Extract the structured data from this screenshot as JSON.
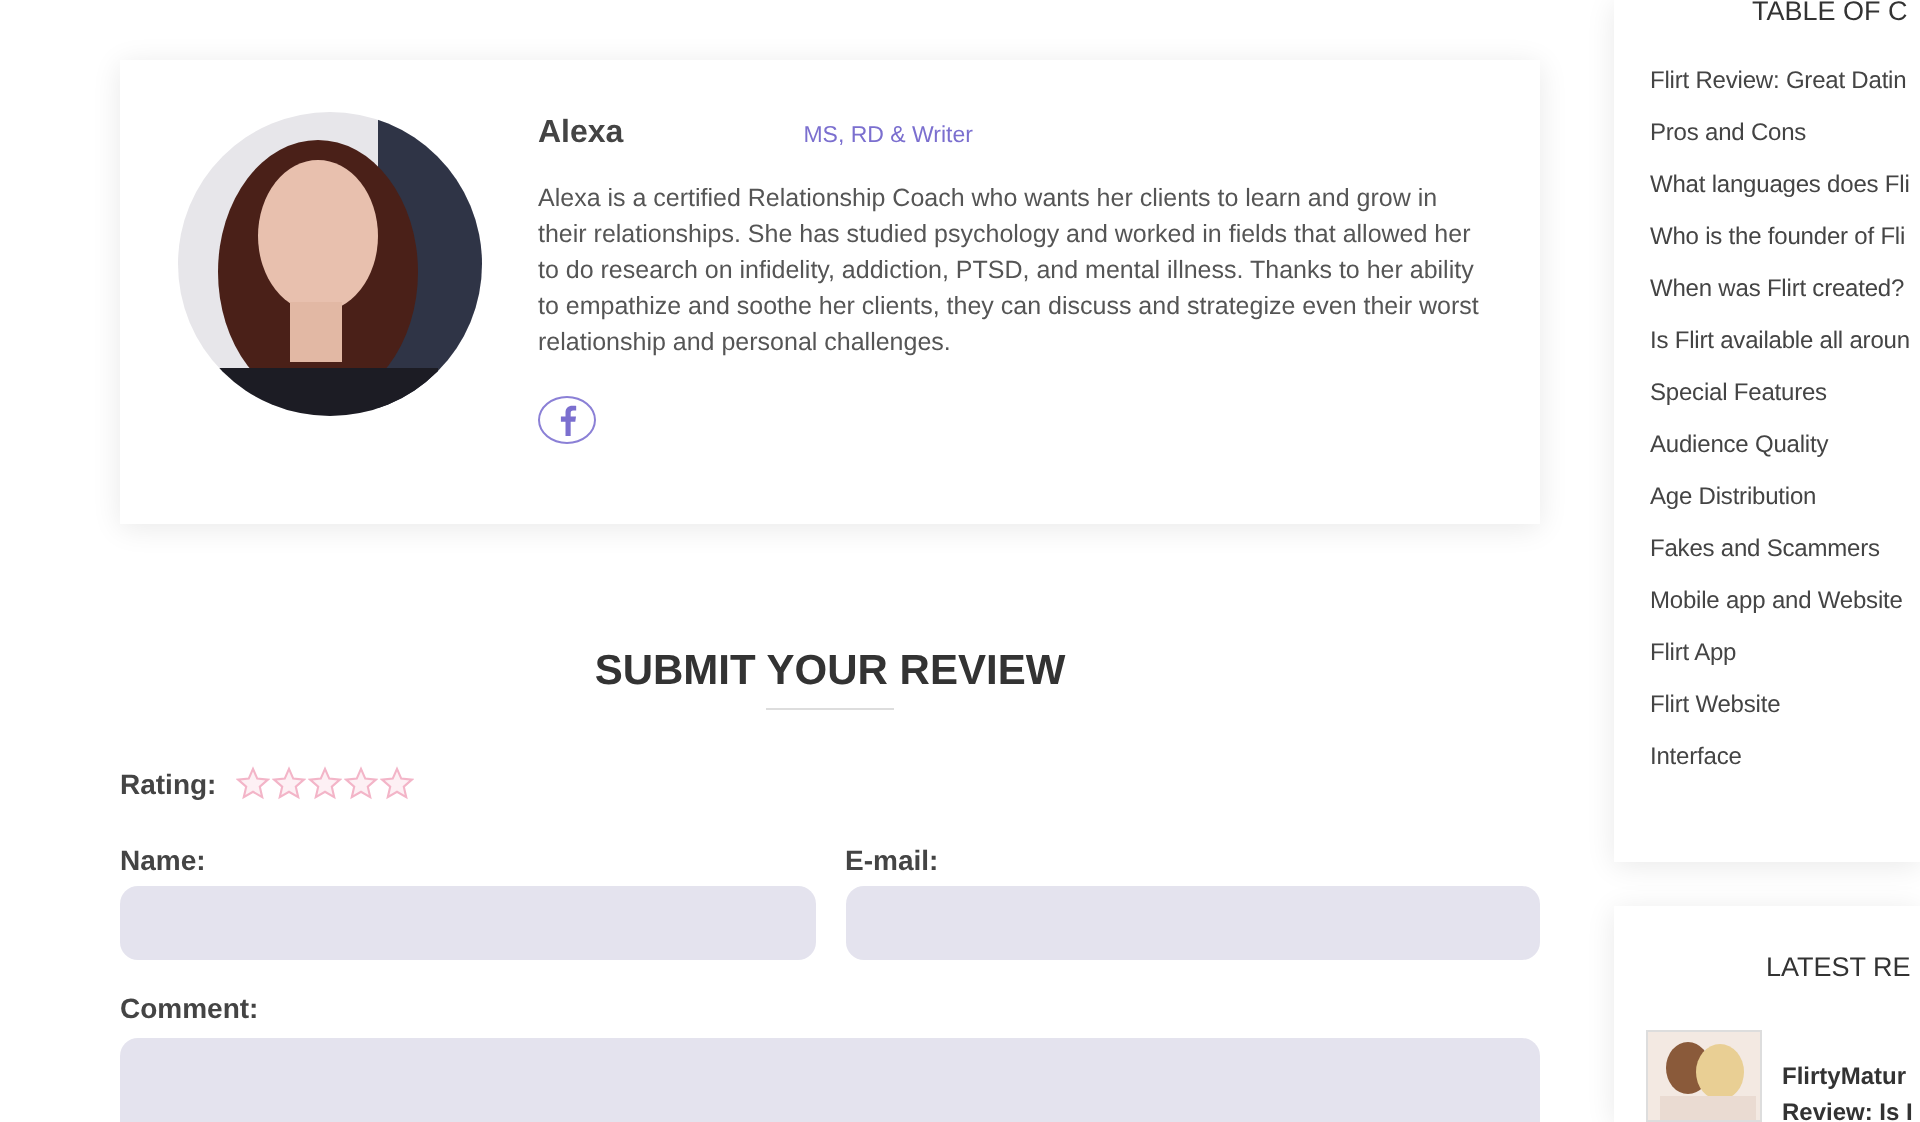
{
  "author": {
    "name": "Alexa",
    "credentials": "MS, RD & Writer",
    "bio": "Alexa is a certified Relationship Coach who wants her clients to learn and grow in their relationships. She has studied psychology and worked in fields that allowed her to do research on infidelity, addiction, PTSD, and mental illness. Thanks to her ability to empathize and soothe her clients, they can discuss and strategize even their worst relationship and personal challenges."
  },
  "review_form": {
    "title": "SUBMIT YOUR REVIEW",
    "rating_label": "Rating:",
    "stars": 0,
    "name_label": "Name:",
    "email_label": "E-mail:",
    "comment_label": "Comment:"
  },
  "toc": {
    "title": "TABLE OF C",
    "items": [
      "Flirt Review: Great Datin",
      "Pros and Cons",
      "What languages does Fli",
      "Who is the founder of Fli",
      "When was Flirt created?",
      "Is Flirt available all aroun",
      "Special Features",
      "Audience Quality",
      "Age Distribution",
      "Fakes and Scammers",
      "Mobile app and Website",
      "Flirt App",
      "Flirt Website",
      "Interface"
    ]
  },
  "latest_reviews": {
    "title": "LATEST RE",
    "items": [
      {
        "lines": [
          "FlirtyMatur",
          "Review: Is I"
        ]
      }
    ]
  }
}
